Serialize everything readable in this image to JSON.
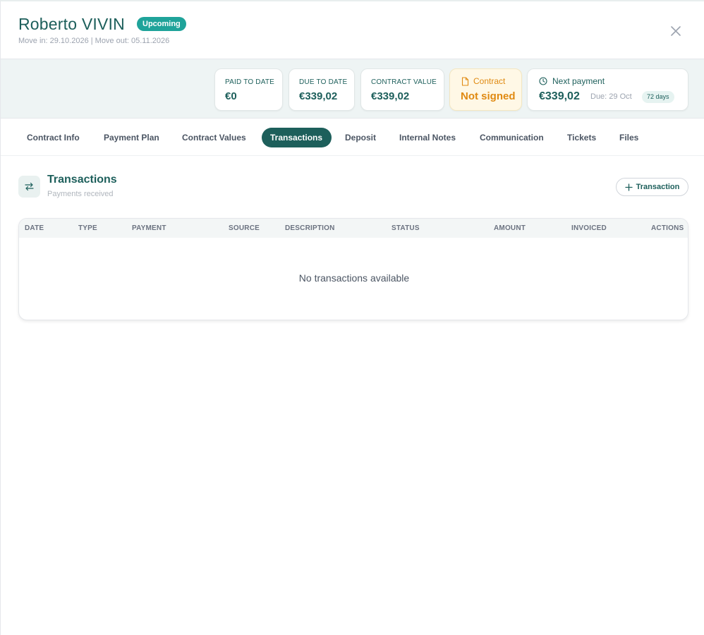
{
  "header": {
    "name": "Roberto VIVIN",
    "status_badge": "Upcoming",
    "dates": "Move in: 29.10.2026 | Move out: 05.11.2026"
  },
  "summary": {
    "paid_to_date": {
      "label": "PAID TO DATE",
      "value": "€0"
    },
    "due_to_date": {
      "label": "DUE TO DATE",
      "value": "€339,02"
    },
    "contract_value": {
      "label": "CONTRACT VALUE",
      "value": "€339,02"
    },
    "contract": {
      "label": "Contract",
      "value": "Not signed"
    },
    "next_payment": {
      "label": "Next payment",
      "amount": "€339,02",
      "due": "Due: 29 Oct",
      "days": "72 days"
    }
  },
  "tabs": [
    {
      "label": "Contract Info"
    },
    {
      "label": "Payment Plan"
    },
    {
      "label": "Contract Values"
    },
    {
      "label": "Transactions"
    },
    {
      "label": "Deposit"
    },
    {
      "label": "Internal Notes"
    },
    {
      "label": "Communication"
    },
    {
      "label": "Tickets"
    },
    {
      "label": "Files"
    }
  ],
  "active_tab": "Transactions",
  "section": {
    "title": "Transactions",
    "subtitle": "Payments received",
    "add_button": "Transaction"
  },
  "table": {
    "columns": [
      "DATE",
      "TYPE",
      "PAYMENT",
      "SOURCE",
      "DESCRIPTION",
      "STATUS",
      "AMOUNT",
      "INVOICED",
      "ACTIONS"
    ],
    "empty_message": "No transactions available"
  },
  "colors": {
    "brand": "#1d5f5b",
    "badge": "#1fa39a",
    "warning": "#e08a12"
  },
  "icons": {
    "close": "close-icon",
    "contract": "document-icon",
    "next_payment": "clock-icon",
    "section": "swap-arrows-icon",
    "add": "plus-icon"
  }
}
